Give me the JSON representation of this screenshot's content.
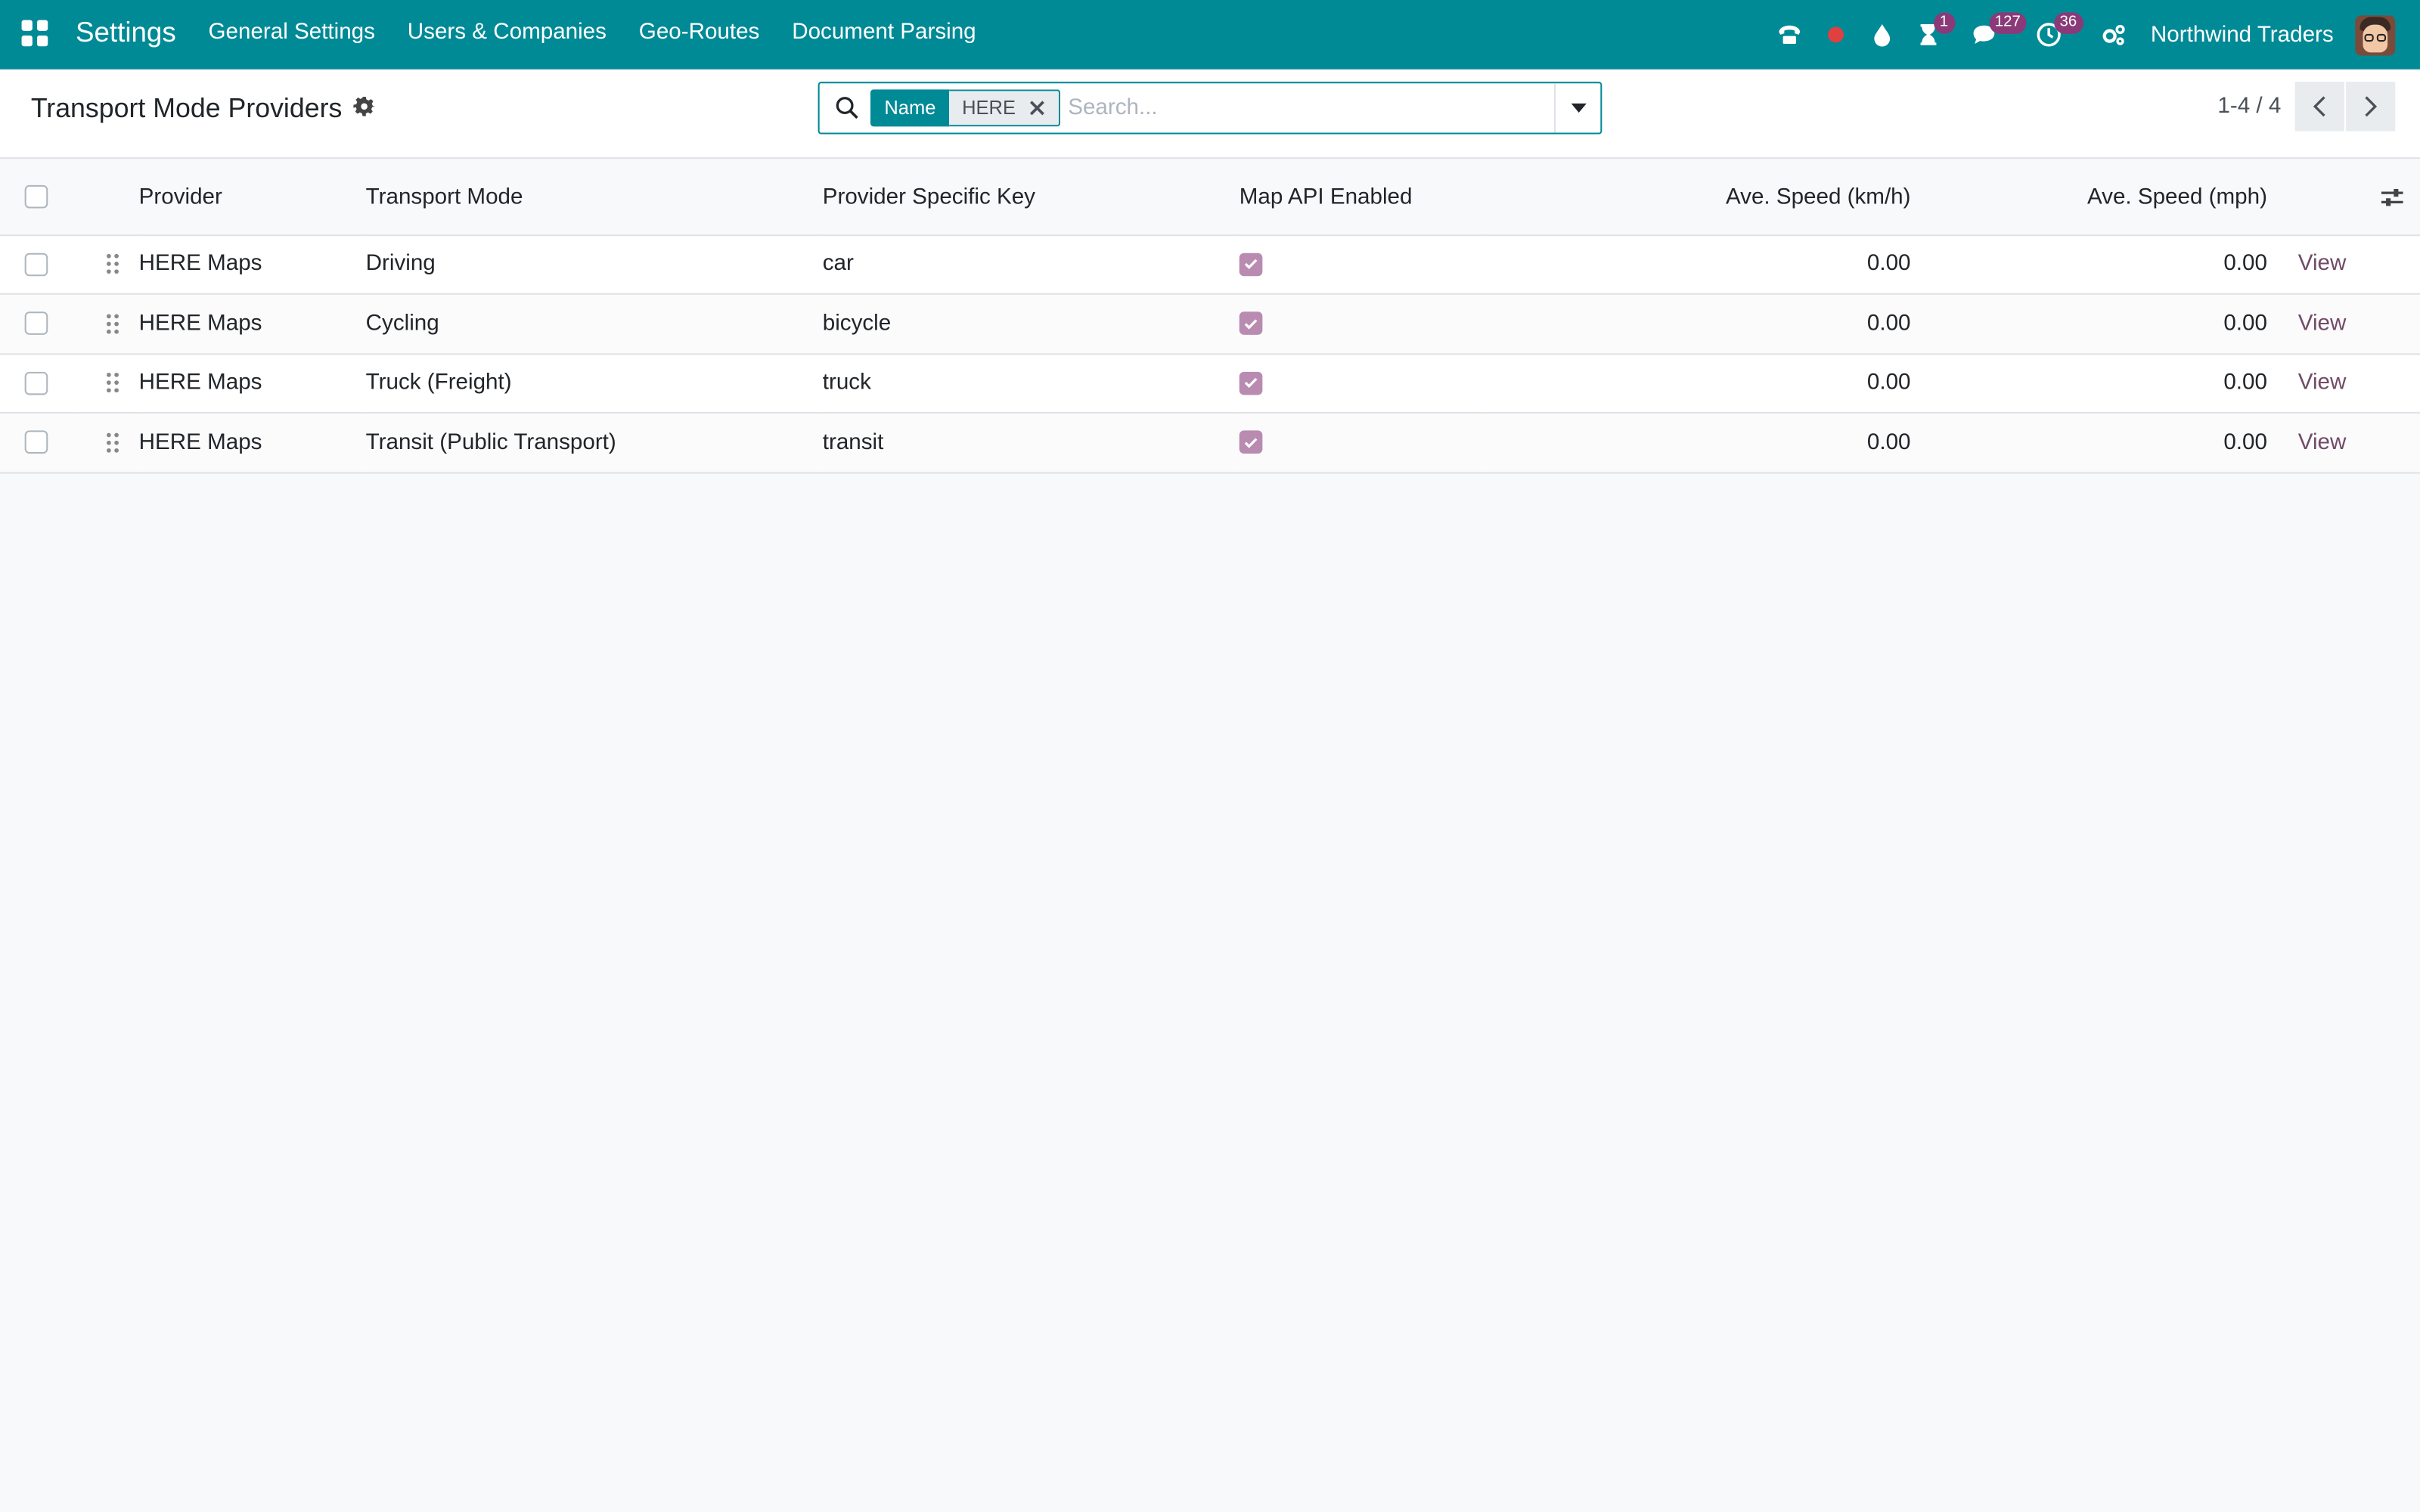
{
  "navbar": {
    "app_name": "Settings",
    "menu": [
      "General Settings",
      "Users & Companies",
      "Geo-Routes",
      "Document Parsing"
    ],
    "systray": {
      "activity_badge": "1",
      "messages_badge": "127",
      "clock_badge": "36"
    },
    "company": "Northwind Traders"
  },
  "control_panel": {
    "title": "Transport Mode Providers",
    "search": {
      "facet_label": "Name",
      "facet_value": "HERE",
      "placeholder": "Search..."
    },
    "pager": "1-4 / 4"
  },
  "table": {
    "columns": [
      "Provider",
      "Transport Mode",
      "Provider Specific Key",
      "Map API Enabled",
      "Ave. Speed (km/h)",
      "Ave. Speed (mph)"
    ],
    "rows": [
      {
        "provider": "HERE Maps",
        "mode": "Driving",
        "key": "car",
        "map_api": true,
        "kmh": "0.00",
        "mph": "0.00",
        "action": "View"
      },
      {
        "provider": "HERE Maps",
        "mode": "Cycling",
        "key": "bicycle",
        "map_api": true,
        "kmh": "0.00",
        "mph": "0.00",
        "action": "View"
      },
      {
        "provider": "HERE Maps",
        "mode": "Truck (Freight)",
        "key": "truck",
        "map_api": true,
        "kmh": "0.00",
        "mph": "0.00",
        "action": "View"
      },
      {
        "provider": "HERE Maps",
        "mode": "Transit (Public Transport)",
        "key": "transit",
        "map_api": true,
        "kmh": "0.00",
        "mph": "0.00",
        "action": "View"
      }
    ]
  },
  "colors": {
    "navbar": "#008a96",
    "link": "#714b67",
    "badge": "#8a3a78",
    "checkbox_checked": "#b98bb0",
    "recording_dot": "#e04040"
  }
}
